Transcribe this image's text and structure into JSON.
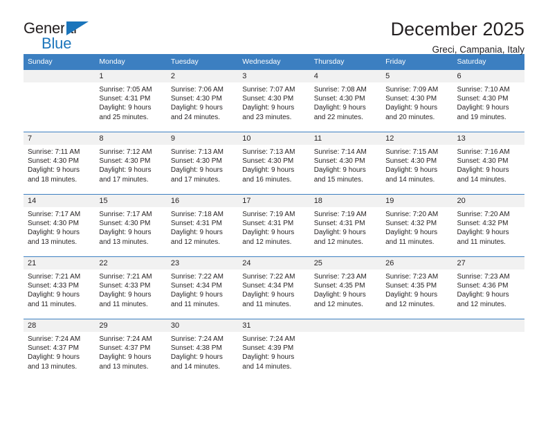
{
  "brand": {
    "name_part1": "General",
    "name_part2": "Blue",
    "accent_color": "#1b75bb"
  },
  "header": {
    "month_title": "December 2025",
    "location": "Greci, Campania, Italy"
  },
  "calendar": {
    "header_color": "#3c7fc1",
    "daynum_background": "#f1f1f1",
    "weekday_headers": [
      "Sunday",
      "Monday",
      "Tuesday",
      "Wednesday",
      "Thursday",
      "Friday",
      "Saturday"
    ],
    "weeks": [
      [
        {
          "day": "",
          "sunrise": "",
          "sunset": "",
          "daylight1": "",
          "daylight2": ""
        },
        {
          "day": "1",
          "sunrise": "Sunrise: 7:05 AM",
          "sunset": "Sunset: 4:31 PM",
          "daylight1": "Daylight: 9 hours",
          "daylight2": "and 25 minutes."
        },
        {
          "day": "2",
          "sunrise": "Sunrise: 7:06 AM",
          "sunset": "Sunset: 4:30 PM",
          "daylight1": "Daylight: 9 hours",
          "daylight2": "and 24 minutes."
        },
        {
          "day": "3",
          "sunrise": "Sunrise: 7:07 AM",
          "sunset": "Sunset: 4:30 PM",
          "daylight1": "Daylight: 9 hours",
          "daylight2": "and 23 minutes."
        },
        {
          "day": "4",
          "sunrise": "Sunrise: 7:08 AM",
          "sunset": "Sunset: 4:30 PM",
          "daylight1": "Daylight: 9 hours",
          "daylight2": "and 22 minutes."
        },
        {
          "day": "5",
          "sunrise": "Sunrise: 7:09 AM",
          "sunset": "Sunset: 4:30 PM",
          "daylight1": "Daylight: 9 hours",
          "daylight2": "and 20 minutes."
        },
        {
          "day": "6",
          "sunrise": "Sunrise: 7:10 AM",
          "sunset": "Sunset: 4:30 PM",
          "daylight1": "Daylight: 9 hours",
          "daylight2": "and 19 minutes."
        }
      ],
      [
        {
          "day": "7",
          "sunrise": "Sunrise: 7:11 AM",
          "sunset": "Sunset: 4:30 PM",
          "daylight1": "Daylight: 9 hours",
          "daylight2": "and 18 minutes."
        },
        {
          "day": "8",
          "sunrise": "Sunrise: 7:12 AM",
          "sunset": "Sunset: 4:30 PM",
          "daylight1": "Daylight: 9 hours",
          "daylight2": "and 17 minutes."
        },
        {
          "day": "9",
          "sunrise": "Sunrise: 7:13 AM",
          "sunset": "Sunset: 4:30 PM",
          "daylight1": "Daylight: 9 hours",
          "daylight2": "and 17 minutes."
        },
        {
          "day": "10",
          "sunrise": "Sunrise: 7:13 AM",
          "sunset": "Sunset: 4:30 PM",
          "daylight1": "Daylight: 9 hours",
          "daylight2": "and 16 minutes."
        },
        {
          "day": "11",
          "sunrise": "Sunrise: 7:14 AM",
          "sunset": "Sunset: 4:30 PM",
          "daylight1": "Daylight: 9 hours",
          "daylight2": "and 15 minutes."
        },
        {
          "day": "12",
          "sunrise": "Sunrise: 7:15 AM",
          "sunset": "Sunset: 4:30 PM",
          "daylight1": "Daylight: 9 hours",
          "daylight2": "and 14 minutes."
        },
        {
          "day": "13",
          "sunrise": "Sunrise: 7:16 AM",
          "sunset": "Sunset: 4:30 PM",
          "daylight1": "Daylight: 9 hours",
          "daylight2": "and 14 minutes."
        }
      ],
      [
        {
          "day": "14",
          "sunrise": "Sunrise: 7:17 AM",
          "sunset": "Sunset: 4:30 PM",
          "daylight1": "Daylight: 9 hours",
          "daylight2": "and 13 minutes."
        },
        {
          "day": "15",
          "sunrise": "Sunrise: 7:17 AM",
          "sunset": "Sunset: 4:30 PM",
          "daylight1": "Daylight: 9 hours",
          "daylight2": "and 13 minutes."
        },
        {
          "day": "16",
          "sunrise": "Sunrise: 7:18 AM",
          "sunset": "Sunset: 4:31 PM",
          "daylight1": "Daylight: 9 hours",
          "daylight2": "and 12 minutes."
        },
        {
          "day": "17",
          "sunrise": "Sunrise: 7:19 AM",
          "sunset": "Sunset: 4:31 PM",
          "daylight1": "Daylight: 9 hours",
          "daylight2": "and 12 minutes."
        },
        {
          "day": "18",
          "sunrise": "Sunrise: 7:19 AM",
          "sunset": "Sunset: 4:31 PM",
          "daylight1": "Daylight: 9 hours",
          "daylight2": "and 12 minutes."
        },
        {
          "day": "19",
          "sunrise": "Sunrise: 7:20 AM",
          "sunset": "Sunset: 4:32 PM",
          "daylight1": "Daylight: 9 hours",
          "daylight2": "and 11 minutes."
        },
        {
          "day": "20",
          "sunrise": "Sunrise: 7:20 AM",
          "sunset": "Sunset: 4:32 PM",
          "daylight1": "Daylight: 9 hours",
          "daylight2": "and 11 minutes."
        }
      ],
      [
        {
          "day": "21",
          "sunrise": "Sunrise: 7:21 AM",
          "sunset": "Sunset: 4:33 PM",
          "daylight1": "Daylight: 9 hours",
          "daylight2": "and 11 minutes."
        },
        {
          "day": "22",
          "sunrise": "Sunrise: 7:21 AM",
          "sunset": "Sunset: 4:33 PM",
          "daylight1": "Daylight: 9 hours",
          "daylight2": "and 11 minutes."
        },
        {
          "day": "23",
          "sunrise": "Sunrise: 7:22 AM",
          "sunset": "Sunset: 4:34 PM",
          "daylight1": "Daylight: 9 hours",
          "daylight2": "and 11 minutes."
        },
        {
          "day": "24",
          "sunrise": "Sunrise: 7:22 AM",
          "sunset": "Sunset: 4:34 PM",
          "daylight1": "Daylight: 9 hours",
          "daylight2": "and 11 minutes."
        },
        {
          "day": "25",
          "sunrise": "Sunrise: 7:23 AM",
          "sunset": "Sunset: 4:35 PM",
          "daylight1": "Daylight: 9 hours",
          "daylight2": "and 12 minutes."
        },
        {
          "day": "26",
          "sunrise": "Sunrise: 7:23 AM",
          "sunset": "Sunset: 4:35 PM",
          "daylight1": "Daylight: 9 hours",
          "daylight2": "and 12 minutes."
        },
        {
          "day": "27",
          "sunrise": "Sunrise: 7:23 AM",
          "sunset": "Sunset: 4:36 PM",
          "daylight1": "Daylight: 9 hours",
          "daylight2": "and 12 minutes."
        }
      ],
      [
        {
          "day": "28",
          "sunrise": "Sunrise: 7:24 AM",
          "sunset": "Sunset: 4:37 PM",
          "daylight1": "Daylight: 9 hours",
          "daylight2": "and 13 minutes."
        },
        {
          "day": "29",
          "sunrise": "Sunrise: 7:24 AM",
          "sunset": "Sunset: 4:37 PM",
          "daylight1": "Daylight: 9 hours",
          "daylight2": "and 13 minutes."
        },
        {
          "day": "30",
          "sunrise": "Sunrise: 7:24 AM",
          "sunset": "Sunset: 4:38 PM",
          "daylight1": "Daylight: 9 hours",
          "daylight2": "and 14 minutes."
        },
        {
          "day": "31",
          "sunrise": "Sunrise: 7:24 AM",
          "sunset": "Sunset: 4:39 PM",
          "daylight1": "Daylight: 9 hours",
          "daylight2": "and 14 minutes."
        },
        {
          "day": "",
          "sunrise": "",
          "sunset": "",
          "daylight1": "",
          "daylight2": ""
        },
        {
          "day": "",
          "sunrise": "",
          "sunset": "",
          "daylight1": "",
          "daylight2": ""
        },
        {
          "day": "",
          "sunrise": "",
          "sunset": "",
          "daylight1": "",
          "daylight2": ""
        }
      ]
    ]
  }
}
